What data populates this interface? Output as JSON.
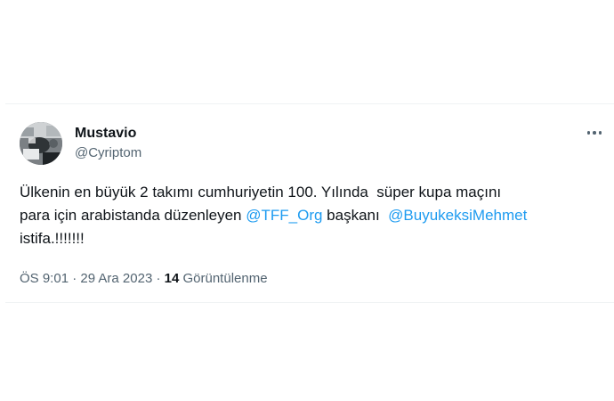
{
  "tweet": {
    "author": {
      "display_name": "Mustavio",
      "handle": "@Cyriptom",
      "avatar_icon": "profile-photo"
    },
    "more_icon": "ellipsis-icon",
    "text": {
      "line1": "Ülkenin en büyük 2 takımı cumhuriyetin 100. Yılında  süper kupa maçını",
      "line2_before": "para için arabistanda düzenleyen ",
      "mention1": "@TFF_Org",
      "line2_middle": " başkanı  ",
      "mention2": "@BuyukeksiMehmet",
      "line3": "istifa.!!!!!!!"
    },
    "meta": {
      "time": "ÖS 9:01",
      "separator1": " · ",
      "date": "29 Ara 2023",
      "separator2": " · ",
      "views_count": "14",
      "views_label": " Görüntülenme"
    },
    "colors": {
      "text": "#0f1419",
      "secondary": "#536471",
      "link": "#1d9bf0",
      "border": "#eff3f4"
    }
  }
}
